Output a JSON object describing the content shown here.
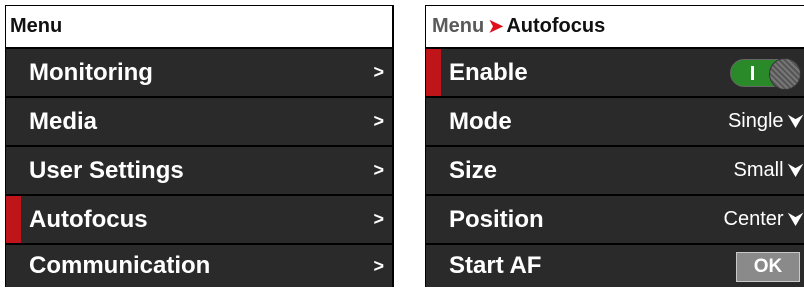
{
  "menu_panel": {
    "header": "Menu",
    "items": [
      {
        "label": "Monitoring",
        "arrow": ">"
      },
      {
        "label": "Media",
        "arrow": ">"
      },
      {
        "label": "User Settings",
        "arrow": ">"
      },
      {
        "label": "Autofocus",
        "arrow": ">",
        "selected": true
      },
      {
        "label": "Communication",
        "arrow": ">"
      }
    ]
  },
  "autofocus_panel": {
    "breadcrumb": {
      "root": "Menu",
      "separator": "➤",
      "current": "Autofocus"
    },
    "enable": {
      "label": "Enable",
      "on": true
    },
    "mode": {
      "label": "Mode",
      "value": "Single",
      "chevron": "⮟"
    },
    "size": {
      "label": "Size",
      "value": "Small",
      "chevron": "⮟"
    },
    "position": {
      "label": "Position",
      "value": "Center",
      "chevron": "⮟"
    },
    "start_af": {
      "label": "Start AF",
      "button": "OK"
    }
  },
  "colors": {
    "selection": "#c0141b",
    "toggle_on": "#2a8a2a",
    "breadcrumb_arrow": "#e0101a"
  }
}
